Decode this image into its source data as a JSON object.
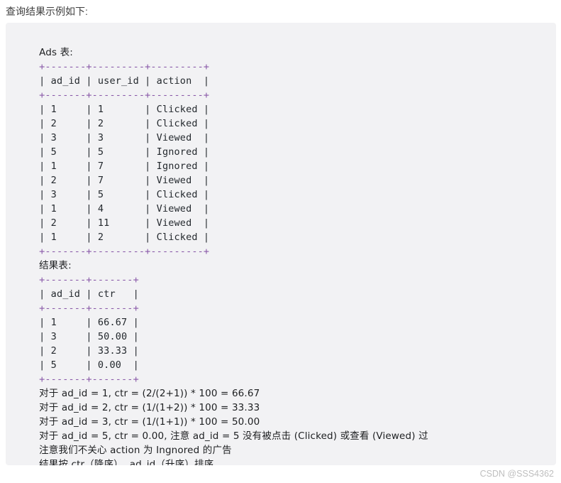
{
  "intro": {
    "text": "查询结果示例如下:"
  },
  "watermark": {
    "text": "CSDN @SSS4362"
  },
  "colors": {
    "page_background": "#ffffff",
    "code_background": "#f2f2f4",
    "code_text": "#1d1f21",
    "separator": "#8959a8",
    "pipe": "#8959a8",
    "punctuation": "#8959a8",
    "intro_text": "#3f3f3f",
    "watermark_text": "#bfbfbf"
  },
  "code": {
    "ads_table": {
      "caption": "Ads 表:",
      "border": "+-------+---------+---------+",
      "header_row": "| ad_id | user_id | action  |",
      "columns": [
        "ad_id",
        "user_id",
        "action"
      ],
      "rows": [
        [
          "1",
          "1",
          "Clicked"
        ],
        [
          "2",
          "2",
          "Clicked"
        ],
        [
          "3",
          "3",
          "Viewed"
        ],
        [
          "5",
          "5",
          "Ignored"
        ],
        [
          "1",
          "7",
          "Ignored"
        ],
        [
          "2",
          "7",
          "Viewed"
        ],
        [
          "3",
          "5",
          "Clicked"
        ],
        [
          "1",
          "4",
          "Viewed"
        ],
        [
          "2",
          "11",
          "Viewed"
        ],
        [
          "1",
          "2",
          "Clicked"
        ]
      ],
      "row_lines": [
        "| 1     | 1       | Clicked |",
        "| 2     | 2       | Clicked |",
        "| 3     | 3       | Viewed  |",
        "| 5     | 5       | Ignored |",
        "| 1     | 7       | Ignored |",
        "| 2     | 7       | Viewed  |",
        "| 3     | 5       | Clicked |",
        "| 1     | 4       | Viewed  |",
        "| 2     | 11      | Viewed  |",
        "| 1     | 2       | Clicked |"
      ]
    },
    "result_table": {
      "caption": "结果表:",
      "border": "+-------+-------+",
      "header_row": "| ad_id | ctr   |",
      "columns": [
        "ad_id",
        "ctr"
      ],
      "rows": [
        [
          "1",
          "66.67"
        ],
        [
          "3",
          "50.00"
        ],
        [
          "2",
          "33.33"
        ],
        [
          "5",
          "0.00"
        ]
      ],
      "row_lines": [
        "| 1     | 66.67 |",
        "| 3     | 50.00 |",
        "| 2     | 33.33 |",
        "| 5     | 0.00  |"
      ]
    },
    "explanation_lines": [
      "对于 ad_id = 1, ctr = (2/(2+1)) * 100 = 66.67",
      "对于 ad_id = 2, ctr = (1/(1+2)) * 100 = 33.33",
      "对于 ad_id = 3, ctr = (1/(1+1)) * 100 = 50.00",
      "对于 ad_id = 5, ctr = 0.00, 注意 ad_id = 5 没有被点击 (Clicked) 或查看 (Viewed) 过",
      "注意我们不关心 action 为 Ingnored 的广告",
      "结果按 ctr（降序）, ad_id（升序）排序"
    ]
  }
}
